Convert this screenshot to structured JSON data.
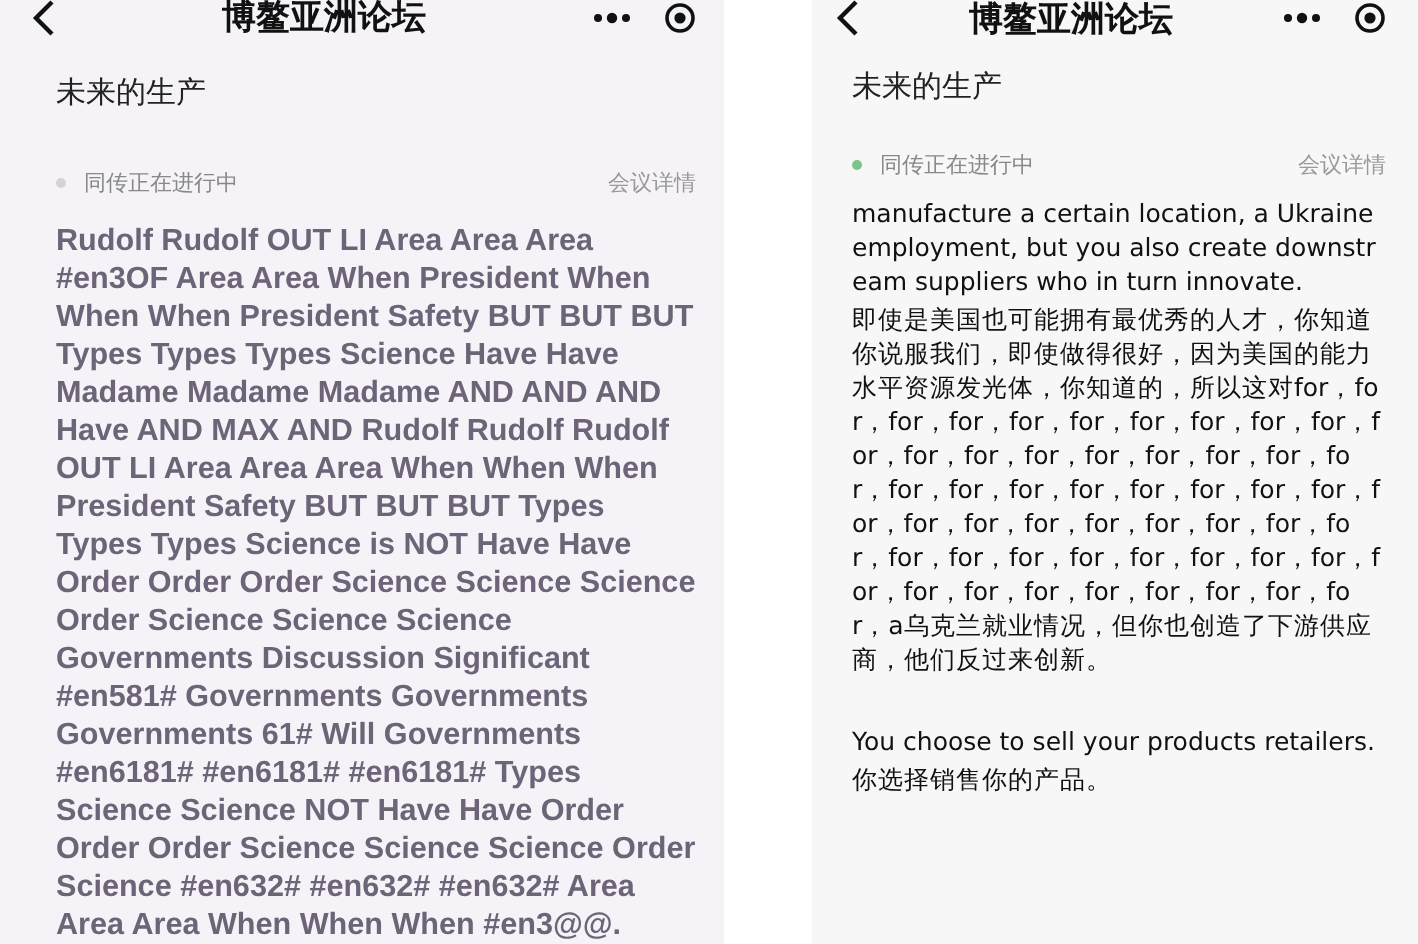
{
  "screens": [
    {
      "kind": "bold",
      "title": "博鳌亚洲论坛",
      "heading": "未来的生产",
      "status": {
        "label": "同传正在进行中",
        "color": "#d4d4d6"
      },
      "details_link": "会议详情",
      "blocks": [
        {
          "lines": [
            "Rudolf Rudolf OUT LI Area Area Area #en3OF Area Area When President When When When President Safety BUT BUT BUT Types Types Types Science Have Have Madame Madame Madame AND AND AND Have AND MAX AND Rudolf Rudolf Rudolf OUT LI Area Area Area When When When President Safety BUT BUT BUT Types Types Types Science is NOT Have Have Order Order Order Science Science Science Order Science Science Science Governments Discussion Significant #en581# Governments Governments Governments 61# Will Governments #en6181# #en6181# #en6181# Types Science Science NOT Have Have Order Order Order Science Science Science Order Science #en632# #en632# #en632# Area Area Area When When When #en3@@."
          ]
        }
      ]
    },
    {
      "kind": "regular",
      "title": "博鳌亚洲论坛",
      "heading": "未来的生产",
      "status": {
        "label": "同传正在进行中",
        "color": "#7cc48a"
      },
      "details_link": "会议详情",
      "blocks": [
        {
          "lines": [
            "manufacture a certain location, a Ukraine employment, but you also create downstream suppliers who in turn innovate.",
            "即使是美国也可能拥有最优秀的人才，你知道你说服我们，即使做得很好，因为美国的能力水平资源发光体，你知道的，所以这对for，for，for，for，for，for，for，for，for，for，for，for，for，for，for，for，for，for，for，for，for，for，for，for，for，for，for，for，for，for，for，for，for，for，for，for，for，for，for，for，for，for，for，for，for，for，for，for，for，for，for，for，for，a乌克兰就业情况，但你也创造了下游供应商，他们反过来创新。"
          ]
        },
        {
          "lines": [
            "You choose to sell your products retailers.",
            "你选择销售你的产品。"
          ]
        }
      ]
    }
  ]
}
